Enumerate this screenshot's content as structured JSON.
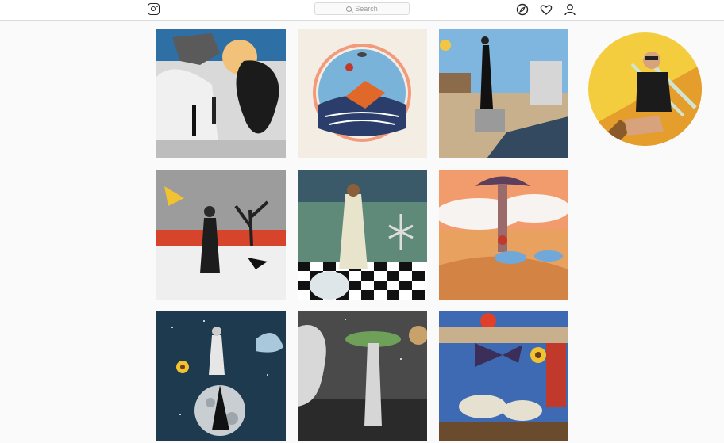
{
  "header": {
    "logo_icon": "instagram-icon",
    "search": {
      "placeholder": "Search",
      "icon": "search-icon"
    },
    "nav_icons": [
      "explore-compass-icon",
      "activity-heart-icon",
      "profile-person-icon"
    ]
  },
  "grid": {
    "posts": [
      {
        "icon": "collage-white-rocks-tree"
      },
      {
        "icon": "collage-butterfly-circle"
      },
      {
        "icon": "collage-woman-castle"
      },
      {
        "icon": "collage-woman-butterfly-trees"
      },
      {
        "icon": "collage-figure-windmills-checkerboard"
      },
      {
        "icon": "collage-mushroom-desert"
      },
      {
        "icon": "collage-moon-jellyfish-sunflower"
      },
      {
        "icon": "collage-statue-baobab"
      },
      {
        "icon": "collage-butterfly-sheep-sunflower"
      }
    ]
  },
  "sidebar": {
    "avatar_icon": "avatar-photo"
  },
  "colors": {
    "background": "#fafafa",
    "border": "#dbdbdb",
    "icon": "#262626"
  }
}
